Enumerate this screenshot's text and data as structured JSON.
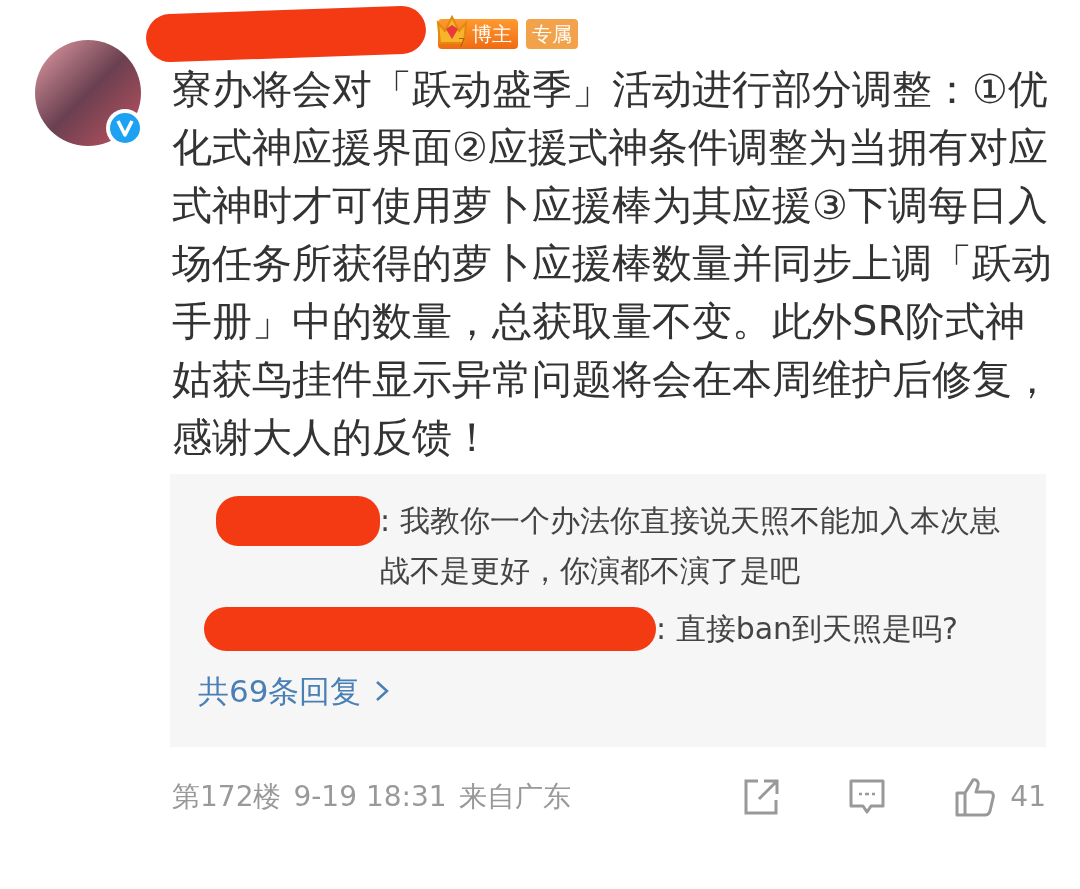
{
  "comment": {
    "verified": true,
    "badges": [
      {
        "kind": "crown",
        "label": "博主",
        "level": "7"
      },
      {
        "kind": "plain",
        "label": "专属"
      }
    ],
    "text": "寮办将会对「跃动盛季」活动进行部分调整：①优化式神应援界面②应援式神条件调整为当拥有对应式神时才可使用萝卜应援棒为其应援③下调每日入场任务所获得的萝卜应援棒数量并同步上调「跃动手册」中的数量，总获取量不变。此外SR阶式神姑获鸟挂件显示异常问题将会在本周维护后修复，感谢大人的反馈！"
  },
  "replies": [
    {
      "text": ": 我教你一个办法你直接说天照不能加入本次崽战不是更好，你演都不演了是吧"
    },
    {
      "text": ": 直接ban到天照是吗?"
    }
  ],
  "reply_count": "共69条回复",
  "footer": {
    "floor": "第172楼",
    "time": "9-19 18:31",
    "location": "来自广东",
    "likes": "41"
  }
}
